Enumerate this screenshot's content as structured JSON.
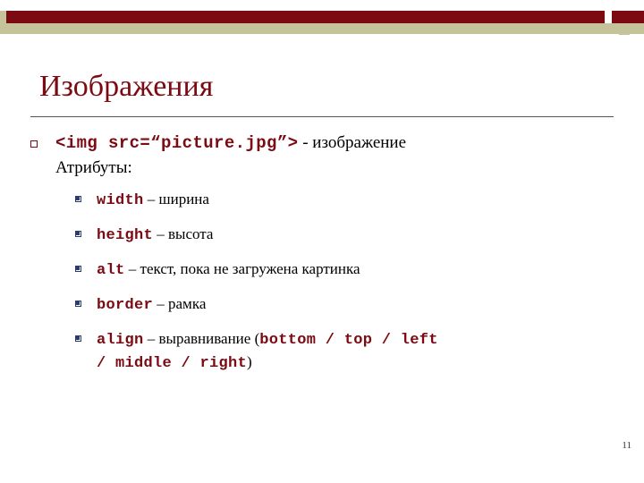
{
  "slide": {
    "title": "Изображения",
    "page_number": "11",
    "colors": {
      "accent_dark_red": "#7b0a12",
      "accent_olive": "#c5c39a",
      "bullet_navy": "#2a3c6e",
      "text": "#000000"
    },
    "main_bullet": {
      "code": "<img src=“picture.jpg”>",
      "after_code": " - изображение",
      "second_line": "Атрибуты:"
    },
    "attributes": [
      {
        "code": "width",
        "desc": " – ширина",
        "extra": "",
        "extra_code": "",
        "tail": ""
      },
      {
        "code": "height",
        "desc": " – высота",
        "extra": "",
        "extra_code": "",
        "tail": ""
      },
      {
        "code": "alt",
        "desc": " – текст, пока не загружена картинка",
        "extra": "",
        "extra_code": "",
        "tail": ""
      },
      {
        "code": "border",
        "desc": " – рамка",
        "extra": "",
        "extra_code": "",
        "tail": ""
      },
      {
        "code": "align",
        "desc": " – выравнивание (",
        "extra_code": "bottom / top / left",
        "extra": "",
        "tail": ""
      }
    ],
    "align_wrap": {
      "code": "/ middle / right",
      "tail": ")"
    }
  }
}
